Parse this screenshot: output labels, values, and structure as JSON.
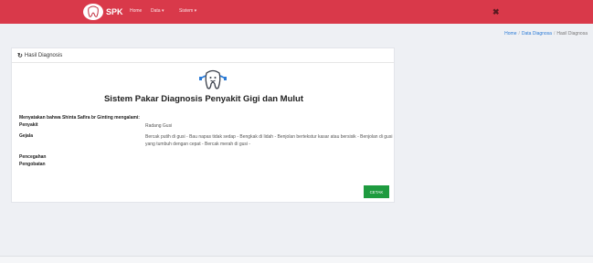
{
  "navbar": {
    "brand": "SPK",
    "links": [
      "Home",
      "Data",
      "Sistem"
    ],
    "toggle_icon": "✖",
    "color": "#d9394a"
  },
  "breadcrumb": {
    "items": [
      "Home",
      "Data Diagnosa",
      "Hasil Diagnosa"
    ],
    "separator": "/"
  },
  "card": {
    "header_icon": "↻",
    "header_title": "Hasil Diagnosis",
    "title": "Sistem Pakar Diagnosis Penyakit Gigi dan Mulut",
    "intro": "Menyatakan bahwa Shinta Safira br Ginting mengalami:",
    "rows": [
      {
        "label": "Penyakit",
        "value": "Radang Gusi"
      },
      {
        "label": "Gejala",
        "value": "Bercak putih di gusi - Bau napas tidak sedap - Bengkak di lidah - Benjolan bertekstur kasar atau bersisik - Benjolan di gusi yang tumbuh dengan cepat - Bercak merah di gusi -"
      },
      {
        "label": "Pencegahan",
        "value": ""
      },
      {
        "label": "Pengobatan",
        "value": ""
      }
    ],
    "button": "CETAK",
    "button_color": "#1e9b3f"
  }
}
